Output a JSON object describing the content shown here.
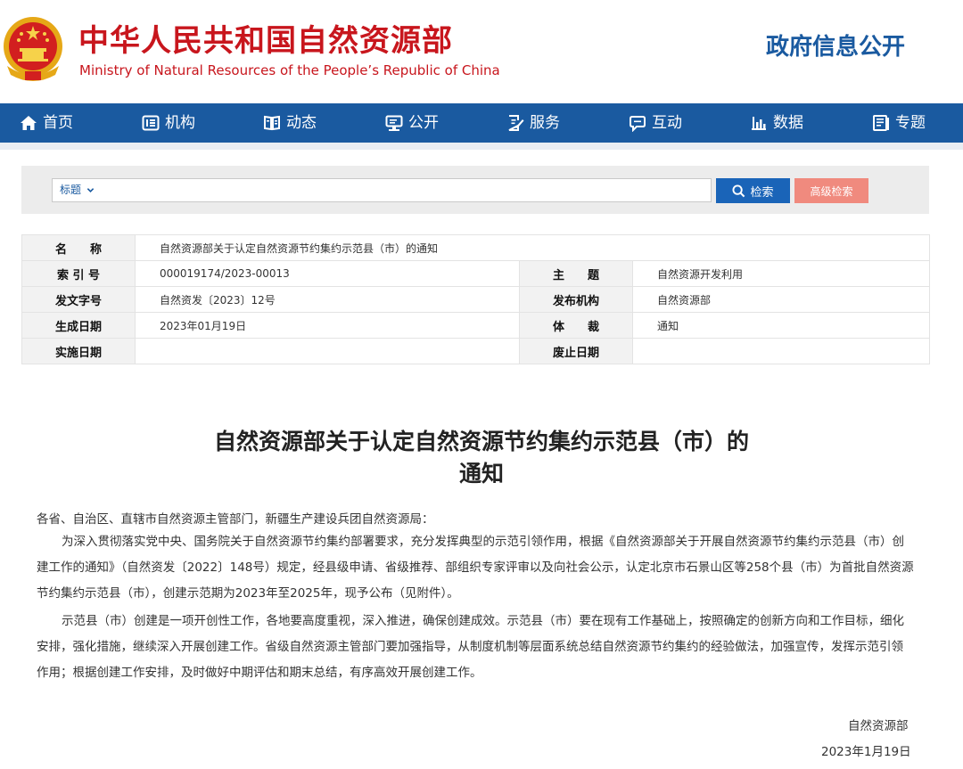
{
  "header": {
    "title_cn": "中华人民共和国自然资源部",
    "title_en": "Ministry of Natural Resources of the People’s Republic of China",
    "gov_info": "政府信息公开"
  },
  "nav": {
    "items": [
      {
        "label": "首页",
        "icon": "home-icon"
      },
      {
        "label": "机构",
        "icon": "org-icon"
      },
      {
        "label": "动态",
        "icon": "news-icon"
      },
      {
        "label": "公开",
        "icon": "public-icon"
      },
      {
        "label": "服务",
        "icon": "service-icon"
      },
      {
        "label": "互动",
        "icon": "chat-icon"
      },
      {
        "label": "数据",
        "icon": "data-icon"
      },
      {
        "label": "专题",
        "icon": "topic-icon"
      }
    ]
  },
  "search": {
    "field_label": "标题",
    "search_label": "检索",
    "advanced_label": "高级检索"
  },
  "meta": {
    "name_label": "名　　称",
    "name_value": "自然资源部关于认定自然资源节约集约示范县（市）的通知",
    "index_label": "索 引 号",
    "index_value": "000019174/2023-00013",
    "subject_label": "主　　题",
    "subject_value": "自然资源开发利用",
    "docno_label": "发文字号",
    "docno_value": "自然资发〔2023〕12号",
    "issuer_label": "发布机构",
    "issuer_value": "自然资源部",
    "created_label": "生成日期",
    "created_value": "2023年01月19日",
    "genre_label": "体　　裁",
    "genre_value": "通知",
    "effective_label": "实施日期",
    "effective_value": "",
    "repeal_label": "废止日期",
    "repeal_value": ""
  },
  "article": {
    "title_line1": "自然资源部关于认定自然资源节约集约示范县（市）的",
    "title_line2": "通知",
    "salutation": "各省、自治区、直辖市自然资源主管部门，新疆生产建设兵团自然资源局：",
    "p1": "为深入贯彻落实党中央、国务院关于自然资源节约集约部署要求，充分发挥典型的示范引领作用，根据《自然资源部关于开展自然资源节约集约示范县（市）创建工作的通知》（自然资发〔2022〕148号）规定，经县级申请、省级推荐、部组织专家评审以及向社会公示，认定北京市石景山区等258个县（市）为首批自然资源节约集约示范县（市），创建示范期为2023年至2025年，现予公布（见附件）。",
    "p2": "示范县（市）创建是一项开创性工作，各地要高度重视，深入推进，确保创建成效。示范县（市）要在现有工作基础上，按照确定的创新方向和工作目标，细化安排，强化措施，继续深入开展创建工作。省级自然资源主管部门要加强指导，从制度机制等层面系统总结自然资源节约集约的经验做法，加强宣传，发挥示范引领作用；根据创建工作安排，及时做好中期评估和期末总结，有序高效开展创建工作。",
    "signature": "自然资源部",
    "date": "2023年1月19日"
  },
  "colors": {
    "brand_red": "#c8161d",
    "brand_blue": "#1a5aa0",
    "advanced_btn": "#f08a7e"
  }
}
